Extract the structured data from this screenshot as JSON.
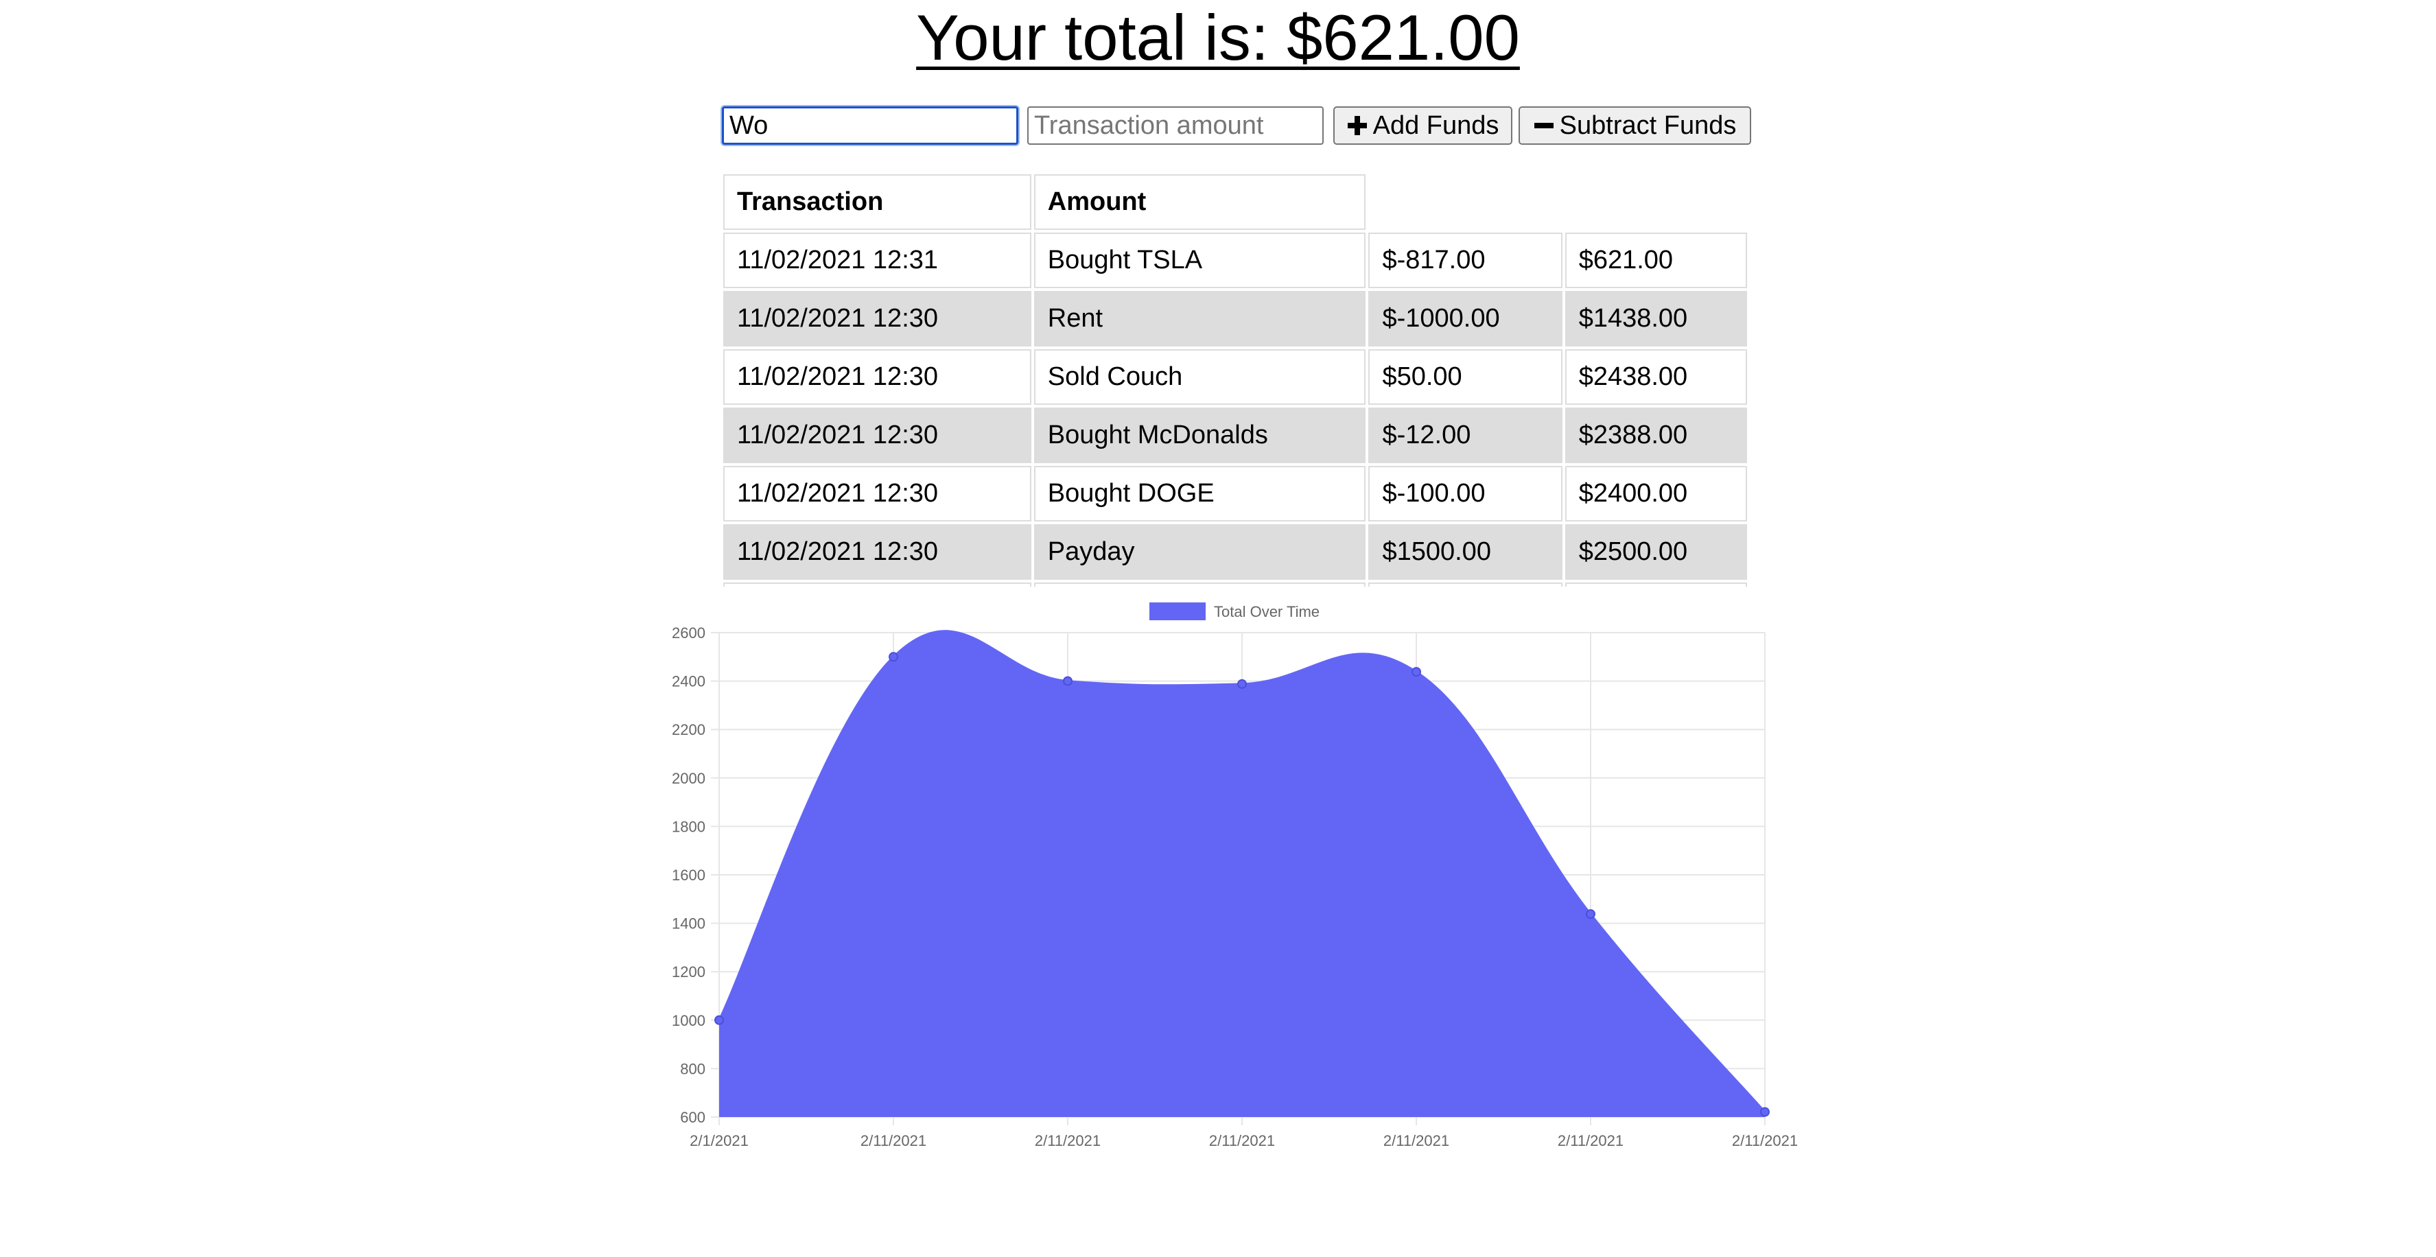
{
  "header": {
    "total_text": "Your total is: $621.00"
  },
  "form": {
    "name_input_value": "Wo",
    "amount_input_placeholder": "Transaction amount",
    "add_button_label": "Add Funds",
    "subtract_button_label": "Subtract Funds"
  },
  "table": {
    "headers": [
      "Transaction",
      "Amount"
    ],
    "rows": [
      {
        "date": "11/02/2021 12:31",
        "name": "Bought TSLA",
        "amount": "$-817.00",
        "total": "$621.00"
      },
      {
        "date": "11/02/2021 12:30",
        "name": "Rent",
        "amount": "$-1000.00",
        "total": "$1438.00"
      },
      {
        "date": "11/02/2021 12:30",
        "name": "Sold Couch",
        "amount": "$50.00",
        "total": "$2438.00"
      },
      {
        "date": "11/02/2021 12:30",
        "name": "Bought McDonalds",
        "amount": "$-12.00",
        "total": "$2388.00"
      },
      {
        "date": "11/02/2021 12:30",
        "name": "Bought DOGE",
        "amount": "$-100.00",
        "total": "$2400.00"
      },
      {
        "date": "11/02/2021 12:30",
        "name": "Payday",
        "amount": "$1500.00",
        "total": "$2500.00"
      }
    ]
  },
  "colors": {
    "chart_fill": "#6366f4",
    "chart_point": "#6366f4",
    "grid": "#e6e6e6",
    "row_shade": "#dddddd",
    "focus_border": "#1a53c7"
  },
  "chart_data": {
    "type": "area",
    "x": [
      "2/1/2021",
      "2/11/2021",
      "2/11/2021",
      "2/11/2021",
      "2/11/2021",
      "2/11/2021",
      "2/11/2021"
    ],
    "series": [
      {
        "name": "Total Over Time",
        "values": [
          1000,
          2500,
          2400,
          2388,
          2438,
          1438,
          621
        ]
      }
    ],
    "ylim": [
      600,
      2600
    ],
    "yticks": [
      600,
      800,
      1000,
      1200,
      1400,
      1600,
      1800,
      2000,
      2200,
      2400,
      2600
    ],
    "grid": true,
    "legend": "top-center",
    "smooth": true
  }
}
